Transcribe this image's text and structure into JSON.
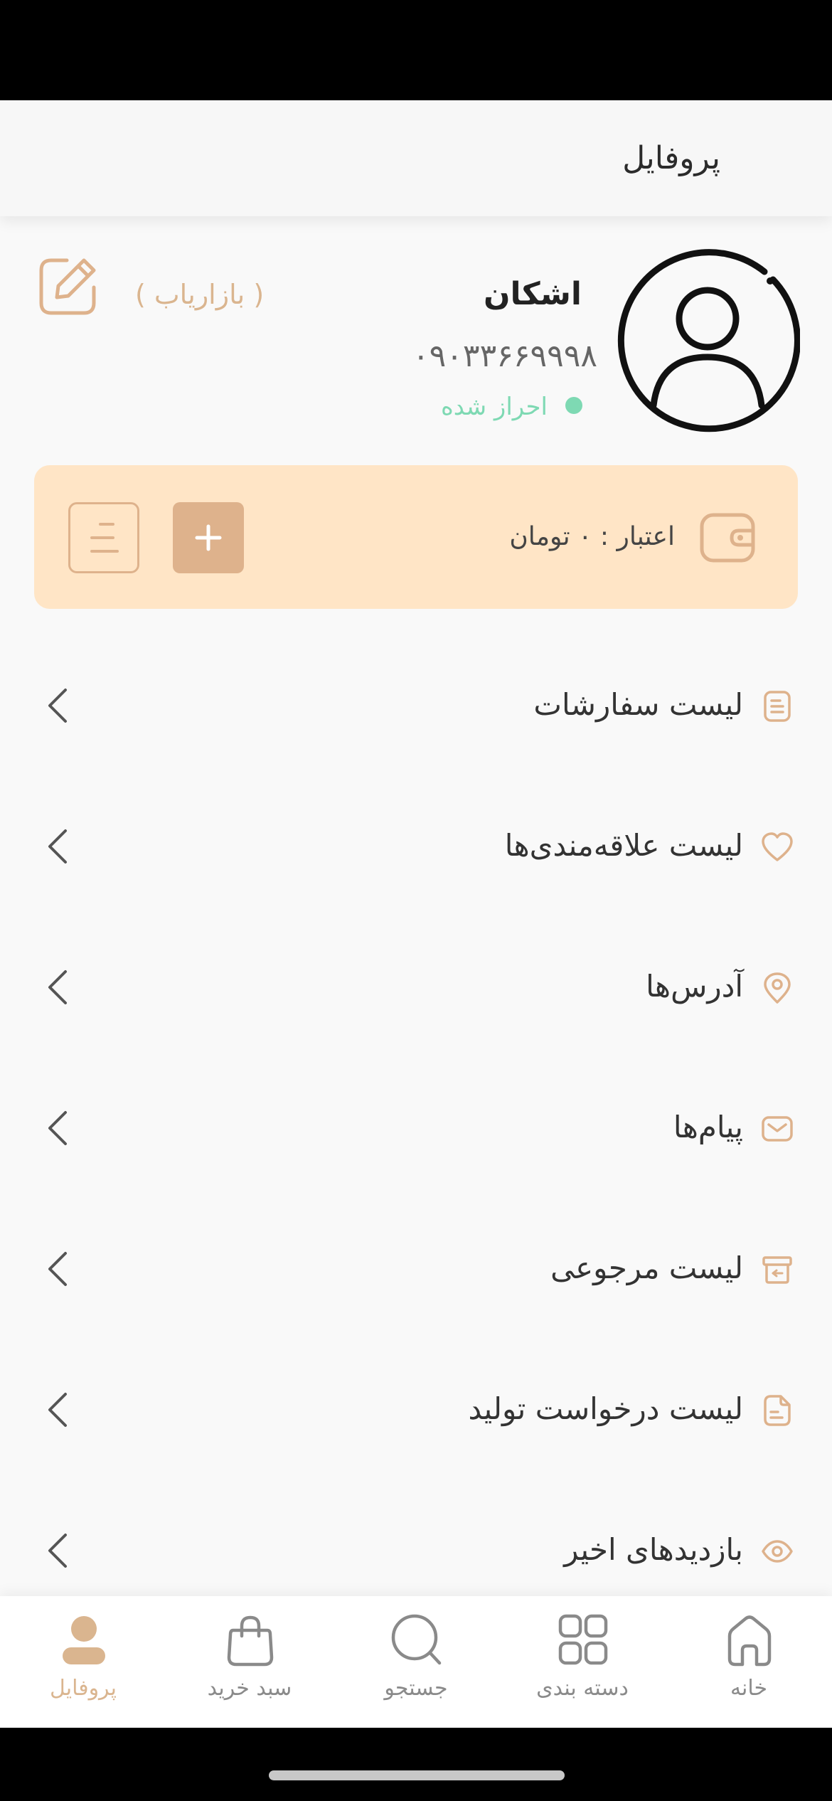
{
  "header": {
    "title": "پروفایل"
  },
  "profile": {
    "name": "اشکان",
    "phone": "۰۹۰۳۳۶۶۹۹۹۸",
    "verified_label": "احراز شده",
    "role": "( بازاریاب )"
  },
  "credit": {
    "label": "اعتبار : ۰ تومان"
  },
  "menu": [
    {
      "label": "لیست سفارشات",
      "icon": "document-icon"
    },
    {
      "label": "لیست علاقه‌مندی‌ها",
      "icon": "heart-icon"
    },
    {
      "label": "آدرس‌ها",
      "icon": "location-pin-icon"
    },
    {
      "label": "پیام‌ها",
      "icon": "mail-icon"
    },
    {
      "label": "لیست مرجوعی",
      "icon": "return-box-icon"
    },
    {
      "label": "لیست درخواست تولید",
      "icon": "request-document-icon"
    },
    {
      "label": "بازدیدهای اخیر",
      "icon": "eye-icon"
    }
  ],
  "nav": [
    {
      "label": "خانه",
      "icon": "home-icon"
    },
    {
      "label": "دسته بندی",
      "icon": "grid-icon"
    },
    {
      "label": "جستجو",
      "icon": "search-icon"
    },
    {
      "label": "سبد خرید",
      "icon": "shopping-bag-icon"
    },
    {
      "label": "پروفایل",
      "icon": "user-icon",
      "active": true
    }
  ],
  "colors": {
    "accent": "#deb28c",
    "accent_text": "#dab58f",
    "card_bg": "#ffe5c6",
    "verified": "#7ed9b3",
    "background": "#f9f9f9"
  }
}
